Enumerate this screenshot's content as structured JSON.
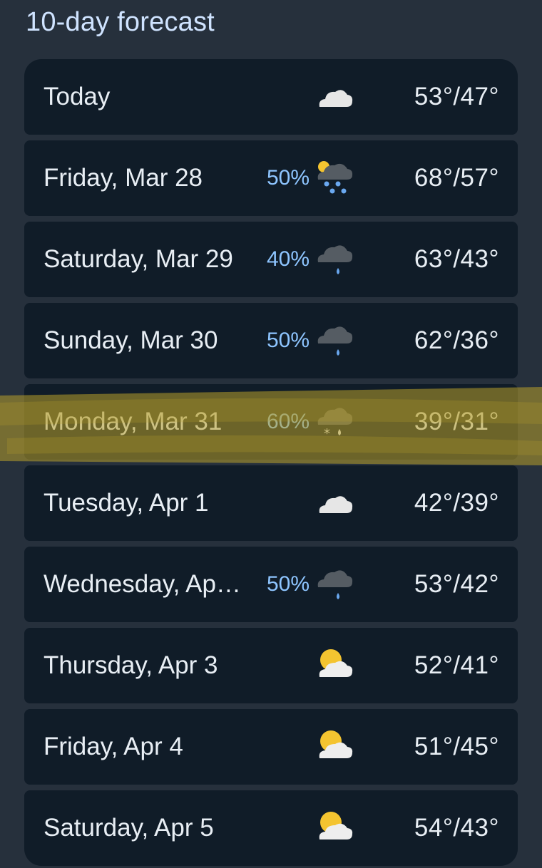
{
  "header": {
    "title": "10-day forecast"
  },
  "forecast": [
    {
      "day": "Today",
      "precip": "",
      "icon": "cloudy-icon",
      "temps": "53°/47°"
    },
    {
      "day": "Friday, Mar 28",
      "precip": "50%",
      "icon": "partly-sunny-rain-icon",
      "temps": "68°/57°"
    },
    {
      "day": "Saturday, Mar 29",
      "precip": "40%",
      "icon": "rain-cloud-icon",
      "temps": "63°/43°"
    },
    {
      "day": "Sunday, Mar 30",
      "precip": "50%",
      "icon": "rain-cloud-icon",
      "temps": "62°/36°"
    },
    {
      "day": "Monday, Mar 31",
      "precip": "60%",
      "icon": "snow-rain-icon",
      "temps": "39°/31°"
    },
    {
      "day": "Tuesday, Apr 1",
      "precip": "",
      "icon": "cloudy-icon",
      "temps": "42°/39°"
    },
    {
      "day": "Wednesday, Ap…",
      "precip": "50%",
      "icon": "rain-cloud-icon",
      "temps": "53°/42°"
    },
    {
      "day": "Thursday, Apr 3",
      "precip": "",
      "icon": "partly-cloudy-icon",
      "temps": "52°/41°"
    },
    {
      "day": "Friday, Apr 4",
      "precip": "",
      "icon": "partly-cloudy-icon",
      "temps": "51°/45°"
    },
    {
      "day": "Saturday, Apr 5",
      "precip": "",
      "icon": "partly-cloudy-icon",
      "temps": "54°/43°"
    }
  ],
  "colors": {
    "background": "#26303c",
    "row": "#101c28",
    "title": "#cfe3ff",
    "precip": "#8ec5ff",
    "highlight": "#b8a12a"
  }
}
